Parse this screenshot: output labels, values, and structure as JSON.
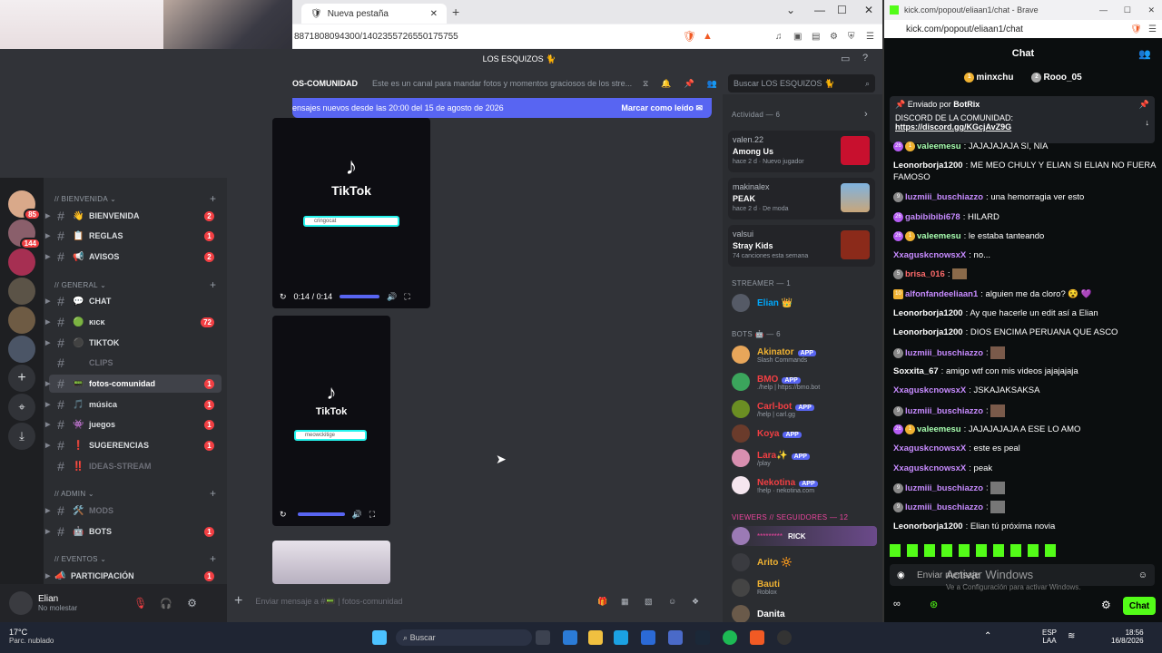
{
  "browser": {
    "tab_title": "Nueva pestaña",
    "url": "8871808094300/1402355726550175755",
    "colors": {
      "accent": "#5865f2"
    }
  },
  "discord": {
    "server_name": "LOS ESQUIZOS 🐈",
    "channel_name": "fotos-comunidad",
    "channel_header_label": "OS-COMUNIDAD",
    "channel_topic": "Este es un canal para mandar fotos y momentos graciosos de los stre...",
    "search_placeholder": "Buscar LOS ESQUIZOS 🐈",
    "new_messages_banner": "ensajes nuevos desde las 20:00 del 15 de agosto de 2026",
    "mark_read_label": "Marcar como leído",
    "composer_placeholder": "Enviar mensaje a #📟 | fotos-comunidad",
    "rail_badges": [
      "85",
      "144"
    ],
    "categories": [
      {
        "label": "// BIENVENIDA"
      },
      {
        "label": "// GENERAL"
      },
      {
        "label": "// ADMIN"
      },
      {
        "label": "// EVENTOS"
      }
    ],
    "channels": [
      {
        "emoji": "👋",
        "label": "BIENVENIDA",
        "badge": "2"
      },
      {
        "emoji": "📋",
        "label": "REGLAS",
        "badge": "1"
      },
      {
        "emoji": "📢",
        "label": "AVISOS",
        "badge": "2"
      },
      {
        "emoji": "💬",
        "label": "CHAT",
        "badge": ""
      },
      {
        "emoji": "🟢",
        "label": "ĸιcĸ",
        "badge": "72"
      },
      {
        "emoji": "⚫",
        "label": "TIKTOK",
        "badge": ""
      },
      {
        "emoji": "",
        "label": "CLIPS",
        "badge": ""
      },
      {
        "emoji": "📟",
        "label": "fotos-comunidad",
        "badge": "1"
      },
      {
        "emoji": "🎵",
        "label": "música",
        "badge": "1"
      },
      {
        "emoji": "👾",
        "label": "juegos",
        "badge": "1"
      },
      {
        "emoji": "❗",
        "label": "SUGERENCIAS",
        "badge": "1"
      },
      {
        "emoji": "‼️",
        "label": "IDEAS-STREAM",
        "badge": ""
      },
      {
        "emoji": "🛠️",
        "label": "MODS",
        "badge": ""
      },
      {
        "emoji": "🤖",
        "label": "BOTS",
        "badge": "1"
      },
      {
        "emoji": "",
        "label": "PARTICIPACIÓN",
        "badge": "1"
      }
    ],
    "user": {
      "name": "Elian",
      "status": "No molestar"
    },
    "videos": [
      {
        "logo": "TikTok",
        "search": "cringocat",
        "time": "0:14 / 0:14"
      },
      {
        "logo": "TikTok",
        "search": "meowckitige"
      }
    ],
    "activity_header": "Actividad — 6",
    "activities": [
      {
        "user": "valen.22",
        "title": "Among Us",
        "sub": "hace 2 d · Nuevo jugador"
      },
      {
        "user": "makinalex",
        "title": "PEAK",
        "sub": "hace 2 d · De moda"
      },
      {
        "user": "valsui",
        "title": "Stray Kids",
        "sub": "74 canciones esta semana"
      }
    ],
    "streamer_header": "STREAMER — 1",
    "streamer": "Elian 👑",
    "bots_header": "BOTS 🤖 — 6",
    "bots": [
      {
        "name": "Akinator",
        "tag": "APP",
        "sub": "Slash Commands",
        "color": "#f0b232"
      },
      {
        "name": "BMO",
        "tag": "APP",
        "sub": "./help | https://bmo.bot",
        "color": "#f23f43"
      },
      {
        "name": "Carl-bot",
        "tag": "APP",
        "sub": "/help | carl.gg",
        "color": "#f23f43"
      },
      {
        "name": "Koya",
        "tag": "APP",
        "sub": "",
        "color": "#f23f43"
      },
      {
        "name": "Lara✨",
        "tag": "APP",
        "sub": "/play",
        "color": "#f23f43"
      },
      {
        "name": "Nekotina",
        "tag": "APP",
        "sub": "!help · nekotina.com",
        "color": "#f23f43"
      }
    ],
    "viewers_header": "VIEWERS // SEGUIDORES — 12",
    "viewers": [
      {
        "name": "RICK",
        "sub": "",
        "color": "#eb459e"
      },
      {
        "name": "Arito 🔆",
        "sub": "",
        "color": "#f0b232"
      },
      {
        "name": "Bauti",
        "sub": "Roblox",
        "color": "#f0b232"
      },
      {
        "name": "Danita",
        "sub": "",
        "color": "#fff"
      }
    ]
  },
  "kick": {
    "window_title": "kick.com/popout/eliaan1/chat - Brave",
    "url": "kick.com/popout/eliaan1/chat",
    "header": "Chat",
    "top_gifters": [
      "minxchu",
      "Rooo_05"
    ],
    "pinned_by_label": "Enviado por",
    "pinned_by": "BotRix",
    "pinned_text": "DISCORD DE LA COMUNIDAD:",
    "pinned_link": "https://discord.gg/KGcjAvZ9G",
    "messages": [
      {
        "user": "valeemesu",
        "text": "JAJAJAJAJA SI, NIA",
        "color": "#a8ffb0"
      },
      {
        "user": "Leonorborja1200",
        "text": "ME MEO CHULY Y ELIAN SI ELIAN NO FUERA FAMOSO",
        "color": "#fff"
      },
      {
        "user": "luzmiii_buschiazzo",
        "text": "una hemorragia ver esto",
        "color": "#c78bff"
      },
      {
        "user": "gabibibibi678",
        "text": "HILARD",
        "color": "#c78bff"
      },
      {
        "user": "valeemesu",
        "text": "le estaba tanteando",
        "color": "#a8ffb0"
      },
      {
        "user": "XxaguskcnowsxX",
        "text": "no...",
        "color": "#c78bff"
      },
      {
        "user": "brisa_016",
        "text": "",
        "color": "#ff6b6b"
      },
      {
        "user": "alfonfandeeliaan1",
        "text": "alguien me da cloro? 😵 💜",
        "color": "#c78bff"
      },
      {
        "user": "Leonorborja1200",
        "text": "Ay que hacerle un edit así a Elian",
        "color": "#fff"
      },
      {
        "user": "Leonorborja1200",
        "text": "DIOS ENCIMA PERUANA QUE ASCO",
        "color": "#fff"
      },
      {
        "user": "luzmiii_buschiazzo",
        "text": "",
        "color": "#c78bff"
      },
      {
        "user": "Soxxita_67",
        "text": "amigo wtf con mis videos jajajajaja",
        "color": "#fff"
      },
      {
        "user": "XxaguskcnowsxX",
        "text": "JSKAJAKSAKSA",
        "color": "#c78bff"
      },
      {
        "user": "luzmiii_buschiazzo",
        "text": "",
        "color": "#c78bff"
      },
      {
        "user": "valeemesu",
        "text": "JAJAJAJAJA A ESE LO AMO",
        "color": "#a8ffb0"
      },
      {
        "user": "XxaguskcnowsxX",
        "text": "este es peal",
        "color": "#c78bff"
      },
      {
        "user": "XxaguskcnowsxX",
        "text": "peak",
        "color": "#c78bff"
      },
      {
        "user": "luzmiii_buschiazzo",
        "text": "",
        "color": "#c78bff"
      },
      {
        "user": "luzmiii_buschiazzo",
        "text": "",
        "color": "#c78bff"
      },
      {
        "user": "Leonorborja1200",
        "text": "Elian tú próxima novia",
        "color": "#fff"
      }
    ],
    "input_placeholder": "Enviar mensaje",
    "chat_button": "Chat",
    "activate_title": "Activar Windows",
    "activate_sub": "Ve a Configuración para activar Windows."
  },
  "taskbar": {
    "temp": "17°C",
    "weather": "Parc. nublado",
    "search": "Buscar",
    "lang": "ESP",
    "lang2": "LAA",
    "time": "18:56",
    "date": "16/8/2026"
  }
}
